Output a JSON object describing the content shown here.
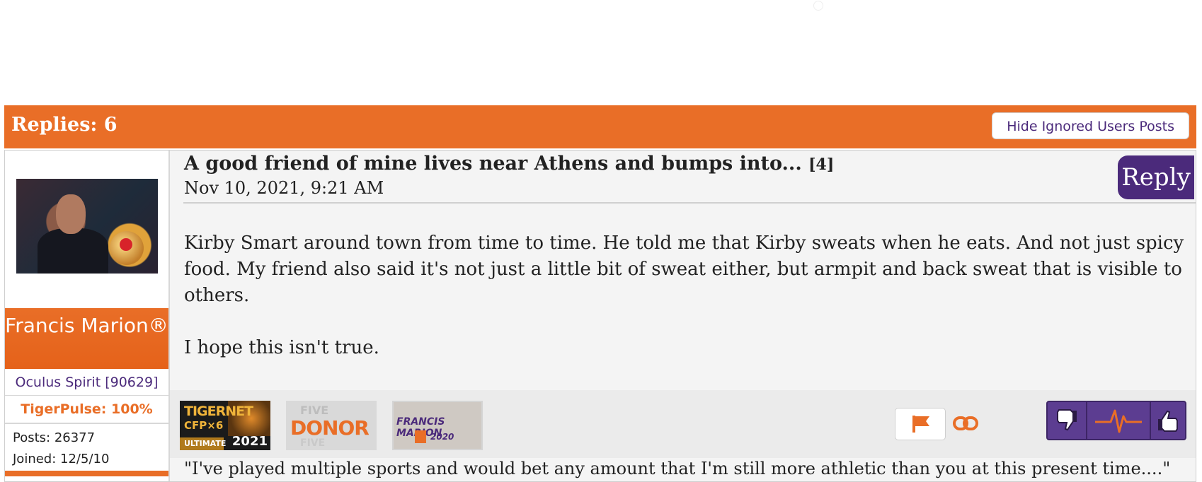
{
  "header": {
    "replies_label": "Replies: 6",
    "hide_ignored_label": "Hide Ignored Users Posts"
  },
  "post": {
    "title": "A good friend of mine lives near Athens and bumps into...",
    "reply_count": "[4]",
    "date": "Nov 10, 2021, 9:21 AM",
    "reply_label": "Reply",
    "body": [
      "Kirby Smart around town from time to time. He told me that Kirby sweats when he eats. And not just spicy food. My friend also said it's not just a little bit of sweat either, but armpit and back sweat that is visible to others.",
      "I hope this isn't true."
    ],
    "signature": "\"I've played multiple sports and would bet any amount that I'm still more athletic than you at this present time....\""
  },
  "user": {
    "name": "Francis Marion®",
    "rank": "Oculus Spirit [90629]",
    "tigerpulse": "TigerPulse: 100%",
    "posts": "Posts: 26377",
    "joined": "Joined: 12/5/10"
  },
  "badges": {
    "cfp": {
      "line1": "TIGERNET",
      "line2": "CFP×6",
      "line3": "ULTIMATE",
      "year": "2021"
    },
    "donor": {
      "top": "FIVE",
      "main": "DONOR",
      "bottom": "FIVE"
    },
    "fm": {
      "name": "FRANCIS MARION",
      "year": "2020"
    }
  },
  "icons": {
    "flag": "flag-icon",
    "link": "link-icon",
    "thumbs_down": "thumbs-down-icon",
    "pulse": "pulse-icon",
    "thumbs_up": "thumbs-up-icon"
  },
  "colors": {
    "orange": "#e96e27",
    "purple": "#4b2a7b",
    "vote_purple": "#5c3d91"
  }
}
